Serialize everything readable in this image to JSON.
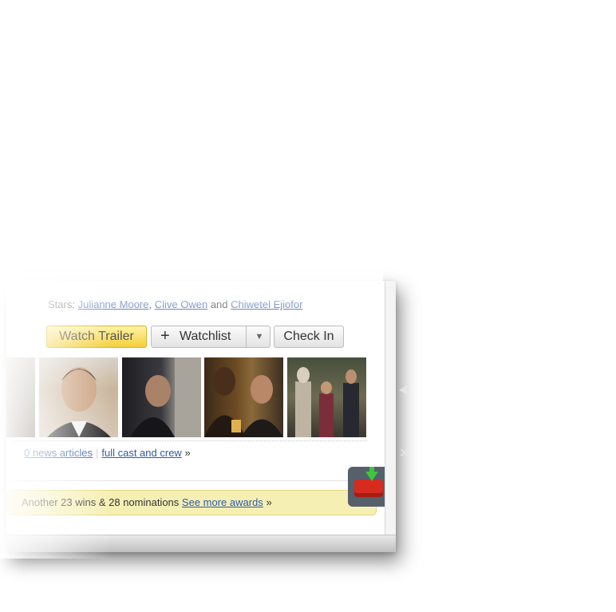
{
  "stars_row": {
    "label": "Stars:",
    "actors": [
      "Julianne Moore",
      "Clive Owen",
      "Chiwetel Ejiofor"
    ],
    "and": "and"
  },
  "buttons": {
    "trailer": "Watch Trailer",
    "watchlist_plus": "+",
    "watchlist": "Watchlist",
    "watchlist_caret": "▼",
    "checkin": "Check In"
  },
  "photos": [
    {
      "name": "photo-partial"
    },
    {
      "name": "photo-clive-owen-portrait"
    },
    {
      "name": "photo-hiding-behind-wall"
    },
    {
      "name": "photo-two-men-pub"
    },
    {
      "name": "photo-group-room"
    }
  ],
  "links": {
    "news": "0 news articles",
    "cast": "full cast and crew",
    "cast_suffix": "»"
  },
  "awards": {
    "text": "Another 23 wins & 28 nominations",
    "link": "See more awards",
    "suffix": "»"
  },
  "colors": {
    "link": "#2f5aa8",
    "trailer_button": "#f3cf3a",
    "awards_bg": "#f5efb4",
    "download_sofa": "#d62b1f",
    "download_arrow": "#3cc83a"
  }
}
